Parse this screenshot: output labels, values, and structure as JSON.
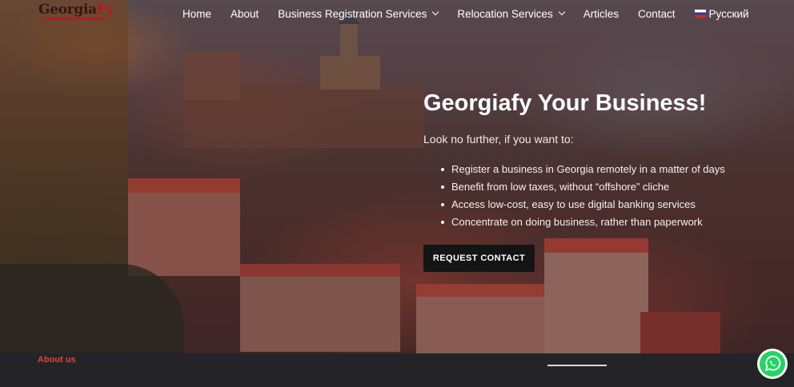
{
  "logo": {
    "text_main": "Georgia",
    "text_accent": "Fy"
  },
  "nav": {
    "items": [
      {
        "label": "Home"
      },
      {
        "label": "About"
      },
      {
        "label": "Business Registration Services",
        "dropdown": true
      },
      {
        "label": "Relocation Services",
        "dropdown": true
      },
      {
        "label": "Articles"
      },
      {
        "label": "Contact"
      },
      {
        "label": "Русский",
        "flag": true
      }
    ]
  },
  "hero": {
    "title": "Georgiafy Your Business!",
    "subtitle": "Look no further, if you want to:",
    "bullets": [
      "Register a business in Georgia remotely in a matter of days",
      "Benefit from low taxes, without “offshore” cliche",
      "Access low-cost, easy to use digital banking services",
      "Concentrate on doing business, rather than paperwork"
    ],
    "cta_label": "REQUEST CONTACT"
  },
  "footer": {
    "about_label": "About us"
  },
  "colors": {
    "accent": "#e2413a",
    "cta_bg": "#141414",
    "whatsapp": "#25d366"
  },
  "icons": {
    "whatsapp": "whatsapp-icon",
    "flag": "russia-flag-icon",
    "chevron": "chevron-down-icon"
  }
}
